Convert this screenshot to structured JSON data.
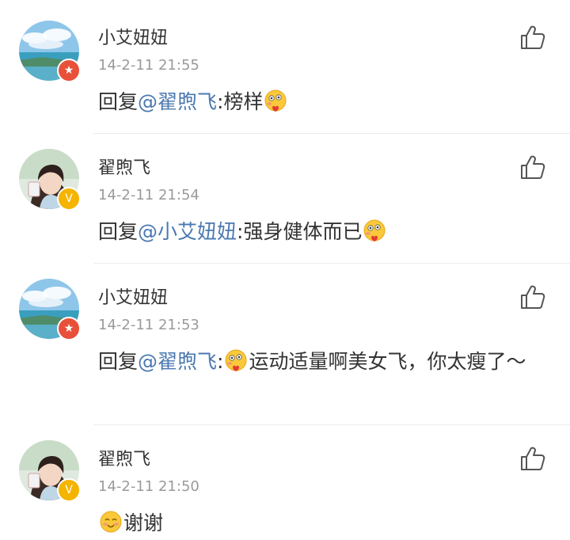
{
  "comments": [
    {
      "username": "小艾妞妞",
      "time": "14-2-11 21:55",
      "reply_prefix": "回复",
      "mention": "@翟煦飞",
      "colon": ":",
      "body_before_emoji": "榜样",
      "body_after_emoji": "",
      "emoji": "blush-emoji",
      "avatar": "landscape-avatar",
      "badge": "red-star-badge"
    },
    {
      "username": "翟煦飞",
      "time": "14-2-11 21:54",
      "reply_prefix": "回复",
      "mention": "@小艾妞妞",
      "colon": ":",
      "body_before_emoji": "强身健体而已",
      "body_after_emoji": "",
      "emoji": "blush-emoji",
      "avatar": "portrait-avatar",
      "badge": "gold-v-badge"
    },
    {
      "username": "小艾妞妞",
      "time": "14-2-11 21:53",
      "reply_prefix": "回复",
      "mention": "@翟煦飞",
      "colon": ":",
      "body_before_emoji": "",
      "body_after_emoji": "运动适量啊美女飞，你太瘦了～",
      "emoji": "blush-emoji",
      "avatar": "landscape-avatar",
      "badge": "red-star-badge"
    },
    {
      "username": "翟煦飞",
      "time": "14-2-11 21:50",
      "reply_prefix": "",
      "mention": "",
      "colon": "",
      "body_before_emoji": "",
      "body_after_emoji": "谢谢",
      "emoji": "smile-emoji",
      "avatar": "portrait-avatar",
      "badge": "gold-v-badge"
    }
  ],
  "colors": {
    "mention": "#4a78b0",
    "time": "#9a9a9a",
    "text": "#333333",
    "red_badge": "#e8503a",
    "gold_badge": "#f5b400"
  },
  "icons": {
    "like": "thumbs-up-icon",
    "verified_red": "star-icon",
    "verified_gold": "v-icon"
  }
}
